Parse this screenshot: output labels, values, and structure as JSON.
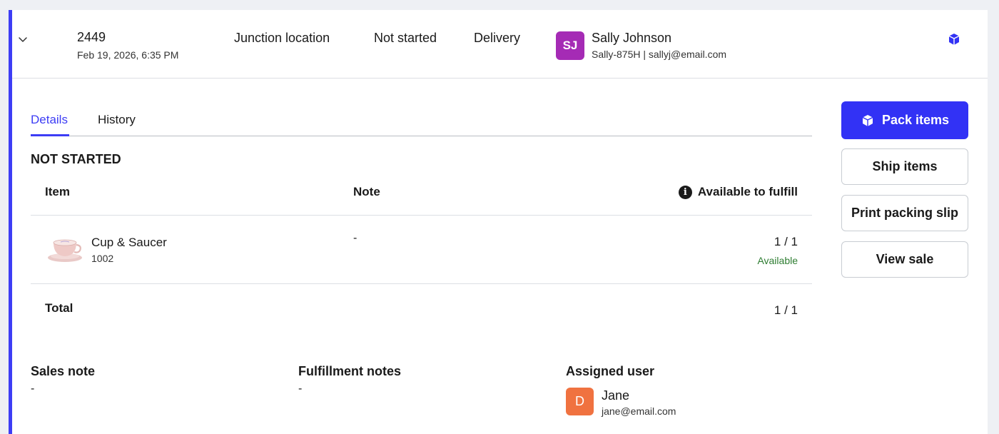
{
  "order": {
    "number": "2449",
    "date": "Feb 19, 2026, 6:35 PM",
    "location": "Junction location",
    "status": "Not started",
    "method": "Delivery",
    "customer": {
      "initials": "SJ",
      "name": "Sally Johnson",
      "meta": "Sally-875H | sallyj@email.com",
      "avatar_color": "#a52bb5"
    },
    "expand_icon": "chevron-down-icon",
    "package_icon": "package-icon"
  },
  "tabs": {
    "details": "Details",
    "history": "History"
  },
  "section_title": "NOT STARTED",
  "table": {
    "headers": {
      "item": "Item",
      "note": "Note",
      "available": "Available to fulfill"
    },
    "rows": [
      {
        "name": "Cup & Saucer",
        "sku": "1002",
        "note": "-",
        "qty": "1 / 1",
        "availability": "Available"
      }
    ],
    "total_label": "Total",
    "total_qty": "1 / 1"
  },
  "footer": {
    "sales_note_label": "Sales note",
    "sales_note_value": "-",
    "fulfillment_notes_label": "Fulfillment notes",
    "fulfillment_notes_value": "-",
    "assigned_user_label": "Assigned user",
    "assigned_user": {
      "initial": "D",
      "name": "Jane",
      "email": "jane@email.com",
      "avatar_color": "#f07240"
    }
  },
  "actions": {
    "pack": "Pack items",
    "ship": "Ship items",
    "print": "Print packing slip",
    "view": "View sale"
  },
  "colors": {
    "accent": "#3d3df5",
    "available": "#2e7d32"
  }
}
